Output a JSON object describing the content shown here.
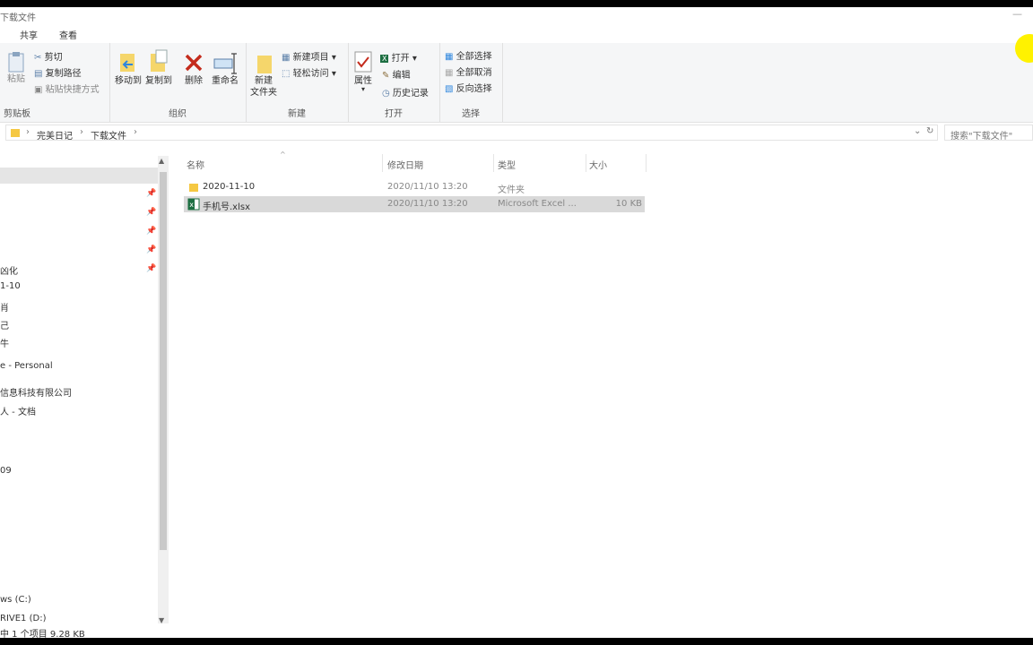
{
  "window": {
    "title": "下载文件"
  },
  "ribbon_tabs": [
    {
      "label": "共享"
    },
    {
      "label": "查看"
    }
  ],
  "ribbon": {
    "clipboard": {
      "paste": "粘贴",
      "cut": "剪切",
      "copy_path": "复制路径",
      "paste_shortcut": "粘贴快捷方式",
      "label": "剪贴板"
    },
    "organize": {
      "move_to": "移动到",
      "copy_to": "复制到",
      "delete": "删除",
      "rename": "重命名",
      "label": "组织"
    },
    "new": {
      "new_folder_line1": "新建",
      "new_folder_line2": "文件夹",
      "new_item": "新建项目",
      "easy_access": "轻松访问",
      "label": "新建"
    },
    "open": {
      "properties": "属性",
      "open": "打开",
      "edit": "编辑",
      "history": "历史记录",
      "label": "打开"
    },
    "select": {
      "select_all": "全部选择",
      "select_none": "全部取消",
      "invert": "反向选择",
      "label": "选择"
    }
  },
  "address": {
    "crumbs": [
      {
        "label": "完美日记"
      },
      {
        "label": "下载文件"
      }
    ],
    "search_placeholder": "搜索\"下载文件\""
  },
  "nav": {
    "items": [
      {
        "label": "凶化"
      },
      {
        "label": "1-10"
      },
      {
        "label": "肖"
      },
      {
        "label": "己"
      },
      {
        "label": "牛"
      },
      {
        "label": "e - Personal"
      },
      {
        "label": "信息科技有限公司"
      },
      {
        "label": "人 - 文档"
      },
      {
        "label": "09"
      },
      {
        "label": "ws  (C:)"
      },
      {
        "label": "RIVE1 (D:)"
      }
    ]
  },
  "columns": {
    "name": "名称",
    "modified": "修改日期",
    "type": "类型",
    "size": "大小"
  },
  "files": [
    {
      "name": "2020-11-10",
      "modified": "2020/11/10 13:20",
      "type": "文件夹",
      "size": "",
      "icon": "folder-icon"
    },
    {
      "name": "手机号.xlsx",
      "modified": "2020/11/10 13:20",
      "type": "Microsoft Excel ...",
      "size": "10 KB",
      "icon": "excel-icon"
    }
  ],
  "status": {
    "text": "中 1 个项目  9.28 KB"
  },
  "colors": {
    "accent_yellow": "#fff200",
    "selection": "#d9d9d9",
    "delete_red": "#c42b1c",
    "excel_green": "#1d6f42"
  }
}
